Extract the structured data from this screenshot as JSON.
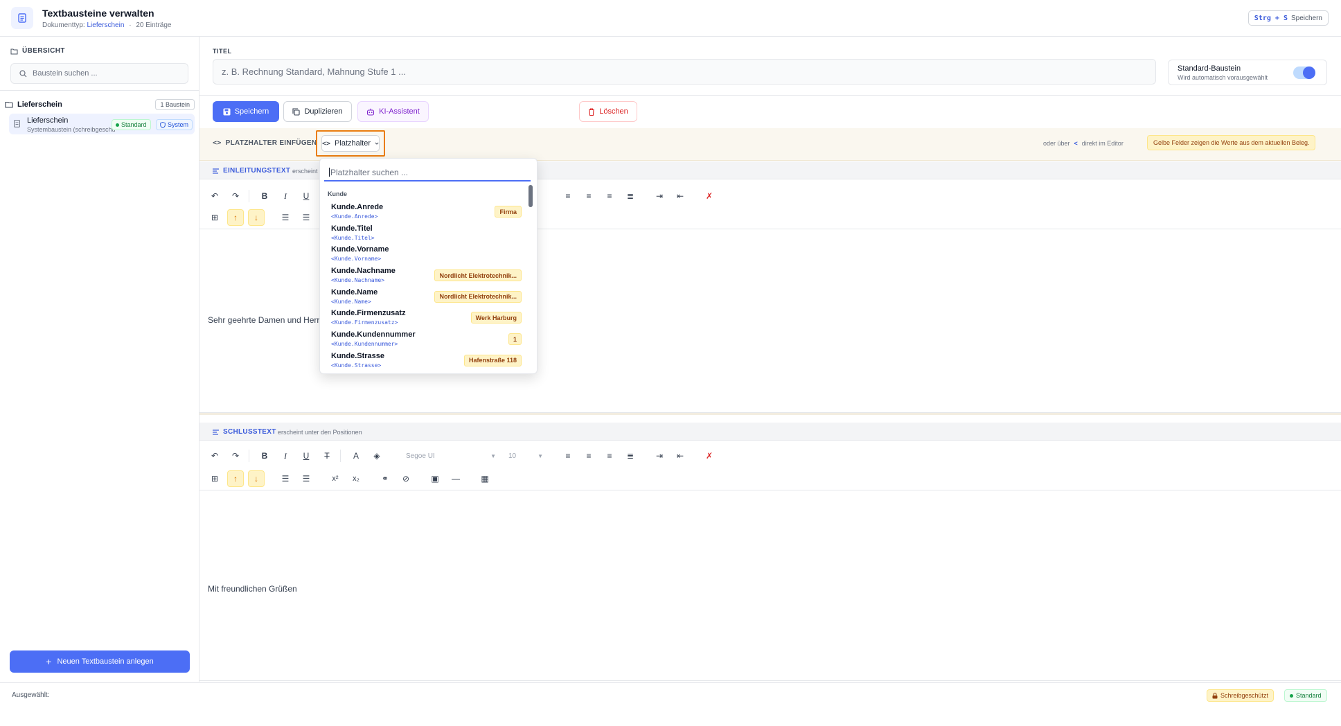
{
  "header": {
    "title": "Textbausteine verwalten",
    "doc_type_label": "Dokumenttyp:",
    "doc_type": "Lieferschein",
    "separator": "·",
    "entries": "20 Einträge",
    "shortcut_keys": "Strg + S",
    "shortcut_label": "Speichern"
  },
  "sidebar": {
    "heading": "ÜBERSICHT",
    "search_placeholder": "Baustein suchen ...",
    "group": {
      "label": "Lieferschein",
      "count": "1 Baustein"
    },
    "item": {
      "name": "Lieferschein",
      "desc": "Systembaustein (schreibgeschützt)",
      "badge_standard": "Standard",
      "badge_system": "System"
    },
    "new_button": "Neuen Textbaustein anlegen"
  },
  "editor": {
    "titel_label": "TITEL",
    "titel_placeholder": "z. B. Rechnung Standard, Mahnung Stufe 1 ...",
    "standard_card": {
      "title": "Standard-Baustein",
      "sub": "Wird automatisch vorausgewählt",
      "toggle_on": true
    },
    "buttons": {
      "save": "Speichern",
      "duplicate": "Duplizieren",
      "ki": "KI-Assistent",
      "delete": "Löschen"
    }
  },
  "placeholder_bar": {
    "label": "PLATZHALTER EINFÜGEN",
    "button": "Platzhalter",
    "hint_prefix": "oder über",
    "hint_arrow": "<",
    "hint_suffix": "direkt im Editor",
    "note": "Gelbe Felder zeigen die Werte aus dem aktuellen Beleg."
  },
  "intro_section": {
    "label": "EINLEITUNGSTEXT",
    "sub": "erscheint über den Positionen",
    "content": "Sehr geehrte Damen und Herren,"
  },
  "closing_section": {
    "label": "SCHLUSSTEXT",
    "sub": "erscheint unter den Positionen",
    "font": "Segoe UI",
    "size": "10",
    "content": "Mit freundlichen Grüßen"
  },
  "dropdown": {
    "search_placeholder": "Platzhalter suchen ...",
    "group": "Kunde",
    "items": [
      {
        "name": "Kunde.Anrede",
        "code": "<Kunde.Anrede>",
        "value": "Firma"
      },
      {
        "name": "Kunde.Titel",
        "code": "<Kunde.Titel>",
        "value": ""
      },
      {
        "name": "Kunde.Vorname",
        "code": "<Kunde.Vorname>",
        "value": ""
      },
      {
        "name": "Kunde.Nachname",
        "code": "<Kunde.Nachname>",
        "value": "Nordlicht Elektrotechnik..."
      },
      {
        "name": "Kunde.Name",
        "code": "<Kunde.Name>",
        "value": "Nordlicht Elektrotechnik..."
      },
      {
        "name": "Kunde.Firmenzusatz",
        "code": "<Kunde.Firmenzusatz>",
        "value": "Werk Harburg"
      },
      {
        "name": "Kunde.Kundennummer",
        "code": "<Kunde.Kundennummer>",
        "value": "1"
      },
      {
        "name": "Kunde.Strasse",
        "code": "<Kunde.Strasse>",
        "value": "Hafenstraße 118"
      }
    ]
  },
  "status": {
    "selected_label": "Ausgewählt:",
    "locked": "Schreibgeschützt",
    "standard": "Standard"
  },
  "colors": {
    "accent": "#4c6ef5",
    "highlight": "#ea7d10",
    "value_bg": "#fef3c7"
  }
}
